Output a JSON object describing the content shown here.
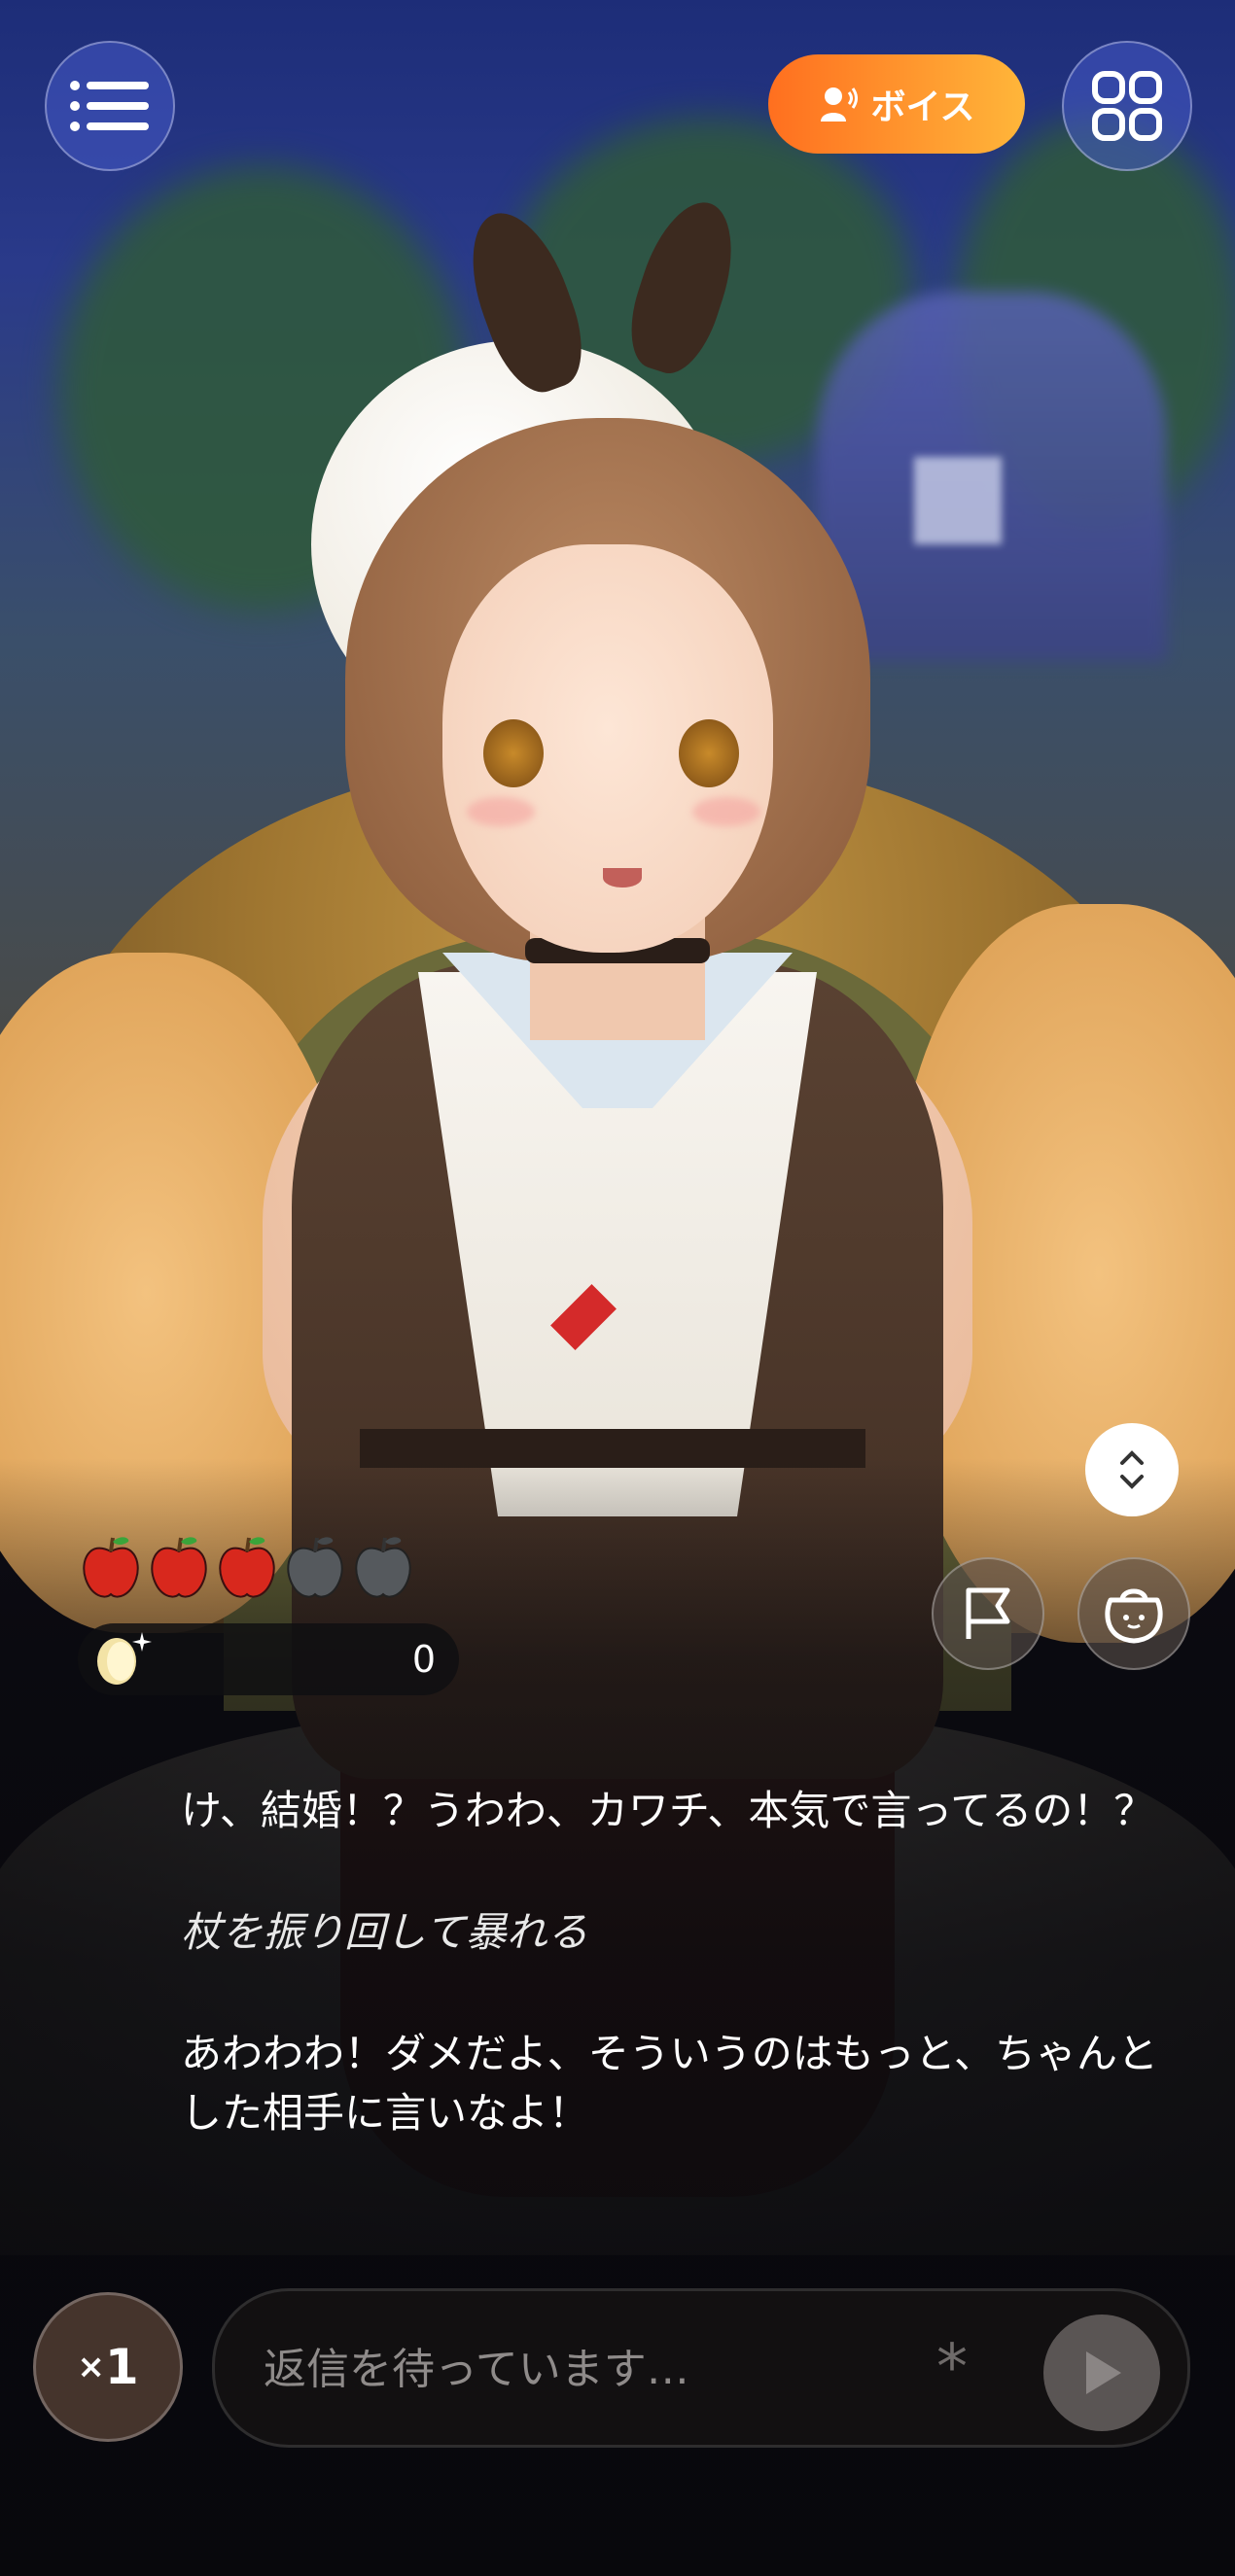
{
  "header": {
    "menu_icon": "menu-list-icon",
    "voice_label": "ボイス",
    "voice_icon": "voice-person-icon",
    "grid_icon": "grid-icon"
  },
  "side_controls": {
    "expand_icon": "expand-collapse-icon",
    "flag_icon": "flag-icon",
    "bag_icon": "bag-icon"
  },
  "status": {
    "apples_total": 5,
    "apples_filled": 3,
    "coins": "0"
  },
  "chat": {
    "line1": "け、結婚！？うわわ、カワチ、本気で言ってるの！？",
    "action": "杖を振り回して暴れる",
    "line2": "あわわわ！ダメだよ、そういうのはもっと、ちゃんとした相手に言いなよ！"
  },
  "composer": {
    "speed_prefix": "×",
    "speed_value": "1",
    "placeholder": "返信を待っています…",
    "asterisk": "*",
    "send_icon": "play-send-icon"
  },
  "colors": {
    "voice_gradient_start": "#ff6f1f",
    "voice_gradient_end": "#ffb63a",
    "apple_filled": "#d8281d",
    "apple_empty": "#55595d"
  }
}
